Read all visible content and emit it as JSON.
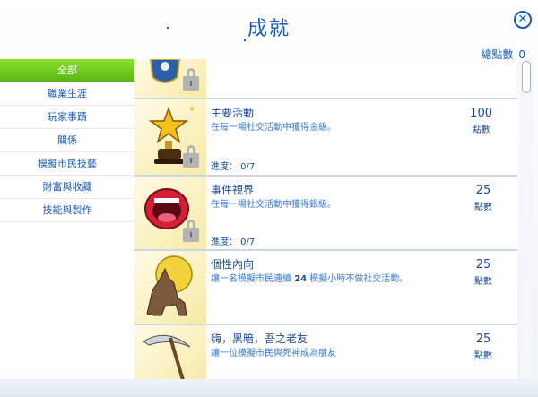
{
  "header": {
    "title": "成就",
    "total_points_label": "總點數",
    "total_points_value": "0"
  },
  "sidebar": {
    "items": [
      {
        "label": "全部",
        "active": true
      },
      {
        "label": "職業生涯",
        "active": false
      },
      {
        "label": "玩家事蹟",
        "active": false
      },
      {
        "label": "關係",
        "active": false
      },
      {
        "label": "模擬市民技藝",
        "active": false
      },
      {
        "label": "財富與收藏",
        "active": false
      },
      {
        "label": "技能與製作",
        "active": false
      }
    ]
  },
  "achievements": [
    {
      "name": "",
      "desc_pre": "",
      "desc_bold": "",
      "desc_post": "",
      "progress": "",
      "points": "",
      "unit": "",
      "icon": "badge-icon"
    },
    {
      "name": "主要活動",
      "desc_pre": "在每一場社交活動中獲得金級。",
      "desc_bold": "",
      "desc_post": "",
      "progress": "進度： 0/7",
      "points": "100",
      "unit": "點數",
      "icon": "gold-star-trophy-icon"
    },
    {
      "name": "事件視界",
      "desc_pre": "在每一場社交活動中獲得銀級。",
      "desc_bold": "",
      "desc_post": "",
      "progress": "進度： 0/7",
      "points": "25",
      "unit": "點數",
      "icon": "open-mouth-icon"
    },
    {
      "name": "個性內向",
      "desc_pre": "讓一名模擬市民連續 ",
      "desc_bold": "24",
      "desc_post": " 模擬小時不做社交活動。",
      "progress": "",
      "points": "25",
      "unit": "點數",
      "icon": "howling-wolf-icon"
    },
    {
      "name": "嗨，黑暗，吾之老友",
      "desc_pre": "讓一位模擬市民與死神成為朋友",
      "desc_bold": "",
      "desc_post": "",
      "progress": "",
      "points": "25",
      "unit": "點數",
      "icon": "scythe-icon"
    }
  ]
}
